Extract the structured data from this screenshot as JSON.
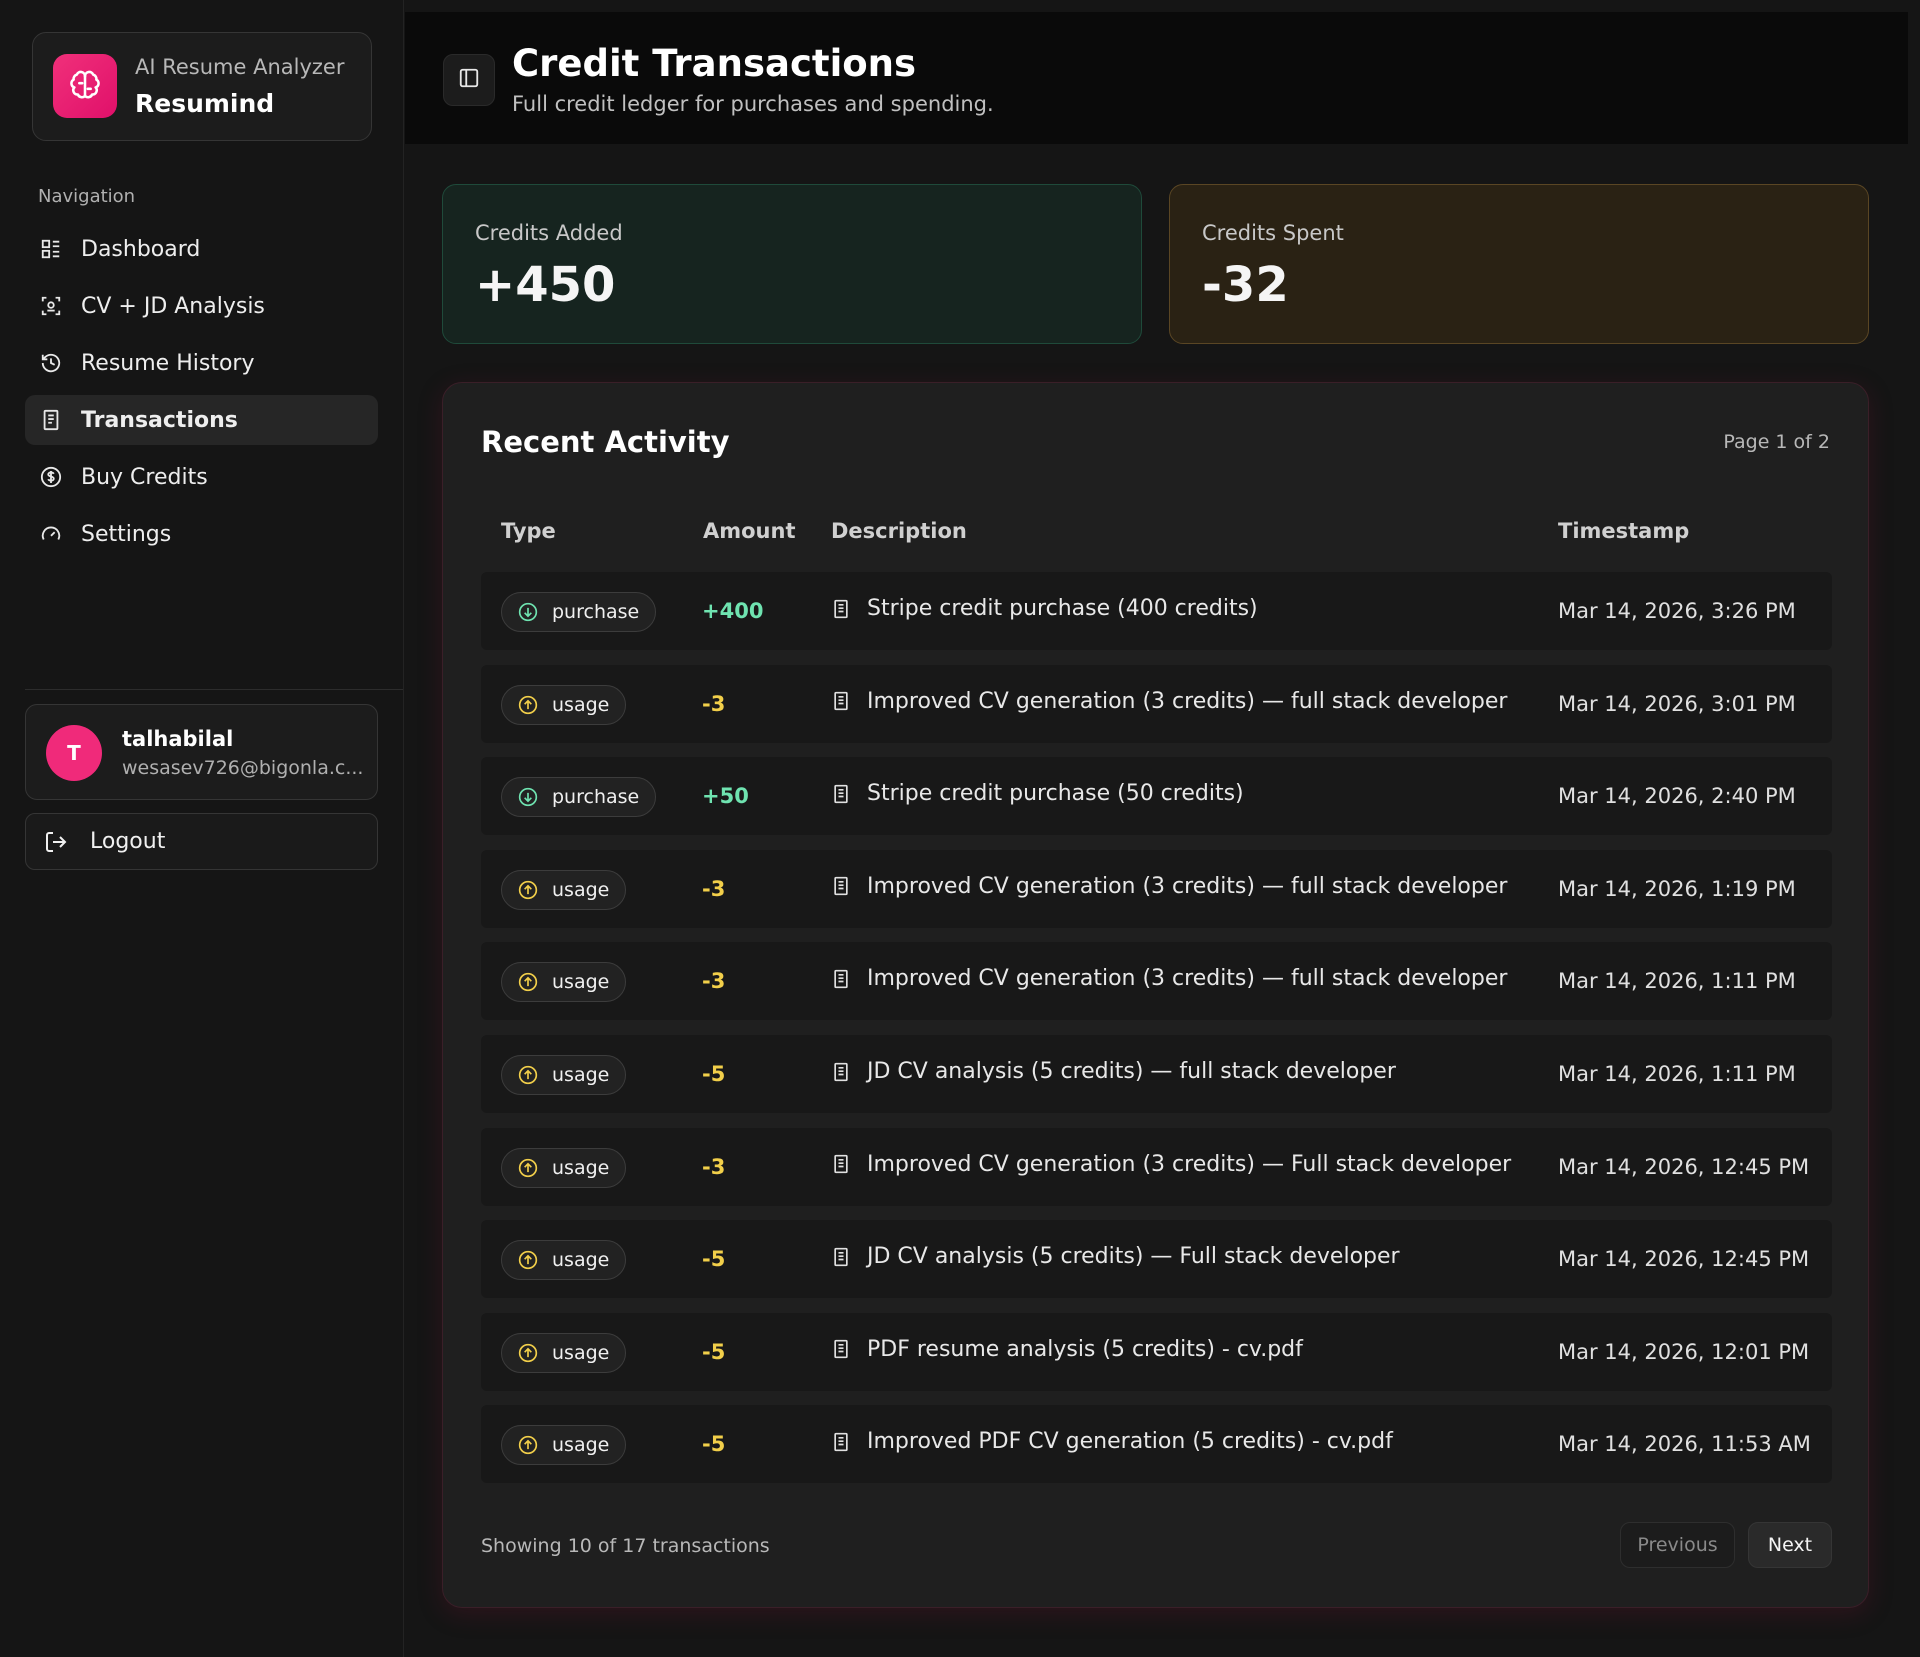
{
  "brand": {
    "subtitle": "AI Resume Analyzer",
    "title": "Resumind",
    "logo_icon": "brain-icon",
    "accent": "#f02a7a"
  },
  "nav": {
    "heading": "Navigation",
    "items": [
      {
        "label": "Dashboard",
        "icon": "dashboard-icon",
        "active": false
      },
      {
        "label": "CV + JD Analysis",
        "icon": "scan-icon",
        "active": false
      },
      {
        "label": "Resume History",
        "icon": "history-icon",
        "active": false
      },
      {
        "label": "Transactions",
        "icon": "receipt-icon",
        "active": true
      },
      {
        "label": "Buy Credits",
        "icon": "dollar-icon",
        "active": false
      },
      {
        "label": "Settings",
        "icon": "gauge-icon",
        "active": false
      }
    ]
  },
  "user": {
    "initial": "T",
    "name": "talhabilal",
    "email": "wesasev726@bigonla.c..."
  },
  "logout": {
    "label": "Logout",
    "icon": "logout-icon"
  },
  "header": {
    "title": "Credit Transactions",
    "subtitle": "Full credit ledger for purchases and spending.",
    "toggle_icon": "sidebar-toggle-icon"
  },
  "stats": {
    "added": {
      "label": "Credits Added",
      "value": "+450",
      "color": "#16241f"
    },
    "spent": {
      "label": "Credits Spent",
      "value": "-32",
      "color": "#2a2214"
    }
  },
  "activity": {
    "title": "Recent Activity",
    "page_info": "Page 1 of 2",
    "columns": {
      "type": "Type",
      "amount": "Amount",
      "description": "Description",
      "timestamp": "Timestamp"
    },
    "rows": [
      {
        "type": "purchase",
        "amount": "+400",
        "description": "Stripe credit purchase (400 credits)",
        "timestamp": "Mar 14, 2026, 3:26 PM"
      },
      {
        "type": "usage",
        "amount": "-3",
        "description": "Improved CV generation (3 credits) — full stack developer",
        "timestamp": "Mar 14, 2026, 3:01 PM"
      },
      {
        "type": "purchase",
        "amount": "+50",
        "description": "Stripe credit purchase (50 credits)",
        "timestamp": "Mar 14, 2026, 2:40 PM"
      },
      {
        "type": "usage",
        "amount": "-3",
        "description": "Improved CV generation (3 credits) — full stack developer",
        "timestamp": "Mar 14, 2026, 1:19 PM"
      },
      {
        "type": "usage",
        "amount": "-3",
        "description": "Improved CV generation (3 credits) — full stack developer",
        "timestamp": "Mar 14, 2026, 1:11 PM"
      },
      {
        "type": "usage",
        "amount": "-5",
        "description": "JD CV analysis (5 credits) — full stack developer",
        "timestamp": "Mar 14, 2026, 1:11 PM"
      },
      {
        "type": "usage",
        "amount": "-3",
        "description": "Improved CV generation (3 credits) — Full stack developer",
        "timestamp": "Mar 14, 2026, 12:45 PM"
      },
      {
        "type": "usage",
        "amount": "-5",
        "description": "JD CV analysis (5 credits) — Full stack developer",
        "timestamp": "Mar 14, 2026, 12:45 PM"
      },
      {
        "type": "usage",
        "amount": "-5",
        "description": "PDF resume analysis (5 credits) - cv.pdf",
        "timestamp": "Mar 14, 2026, 12:01 PM"
      },
      {
        "type": "usage",
        "amount": "-5",
        "description": "Improved PDF CV generation (5 credits) - cv.pdf",
        "timestamp": "Mar 14, 2026, 11:53 AM"
      }
    ],
    "showing": "Showing 10 of 17 transactions",
    "prev_label": "Previous",
    "next_label": "Next"
  },
  "colors": {
    "positive": "#6fe3b0",
    "negative": "#f2cf4a"
  }
}
